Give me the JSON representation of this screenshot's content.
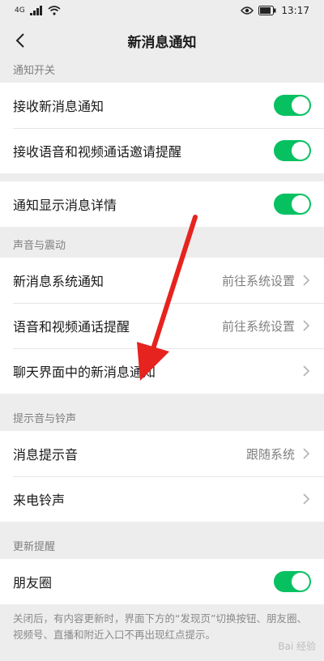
{
  "status_bar": {
    "network": "4G",
    "time": "13:17"
  },
  "nav": {
    "title": "新消息通知"
  },
  "sections": {
    "notify_switch": {
      "header": "通知开关",
      "rows": [
        {
          "label": "接收新消息通知",
          "toggle": true
        },
        {
          "label": "接收语音和视频通话邀请提醒",
          "toggle": true
        }
      ]
    },
    "detail": {
      "rows": [
        {
          "label": "通知显示消息详情",
          "toggle": true
        }
      ]
    },
    "sound_vibration": {
      "header": "声音与震动",
      "rows": [
        {
          "label": "新消息系统通知",
          "value": "前往系统设置"
        },
        {
          "label": "语音和视频通话提醒",
          "value": "前往系统设置"
        },
        {
          "label": "聊天界面中的新消息通知",
          "value": ""
        }
      ]
    },
    "tones": {
      "header": "提示音与铃声",
      "rows": [
        {
          "label": "消息提示音",
          "value": "跟随系统"
        },
        {
          "label": "来电铃声",
          "value": ""
        }
      ]
    },
    "updates": {
      "header": "更新提醒",
      "rows": [
        {
          "label": "朋友圈",
          "toggle": true
        }
      ],
      "note": "关闭后，有内容更新时，界面下方的“发现页”切换按钮、朋友圈、视频号、直播和附近入口不再出现红点提示。"
    }
  },
  "watermark": "Bai 经验",
  "colors": {
    "accent": "#07c160",
    "annotation": "#e6231e"
  }
}
